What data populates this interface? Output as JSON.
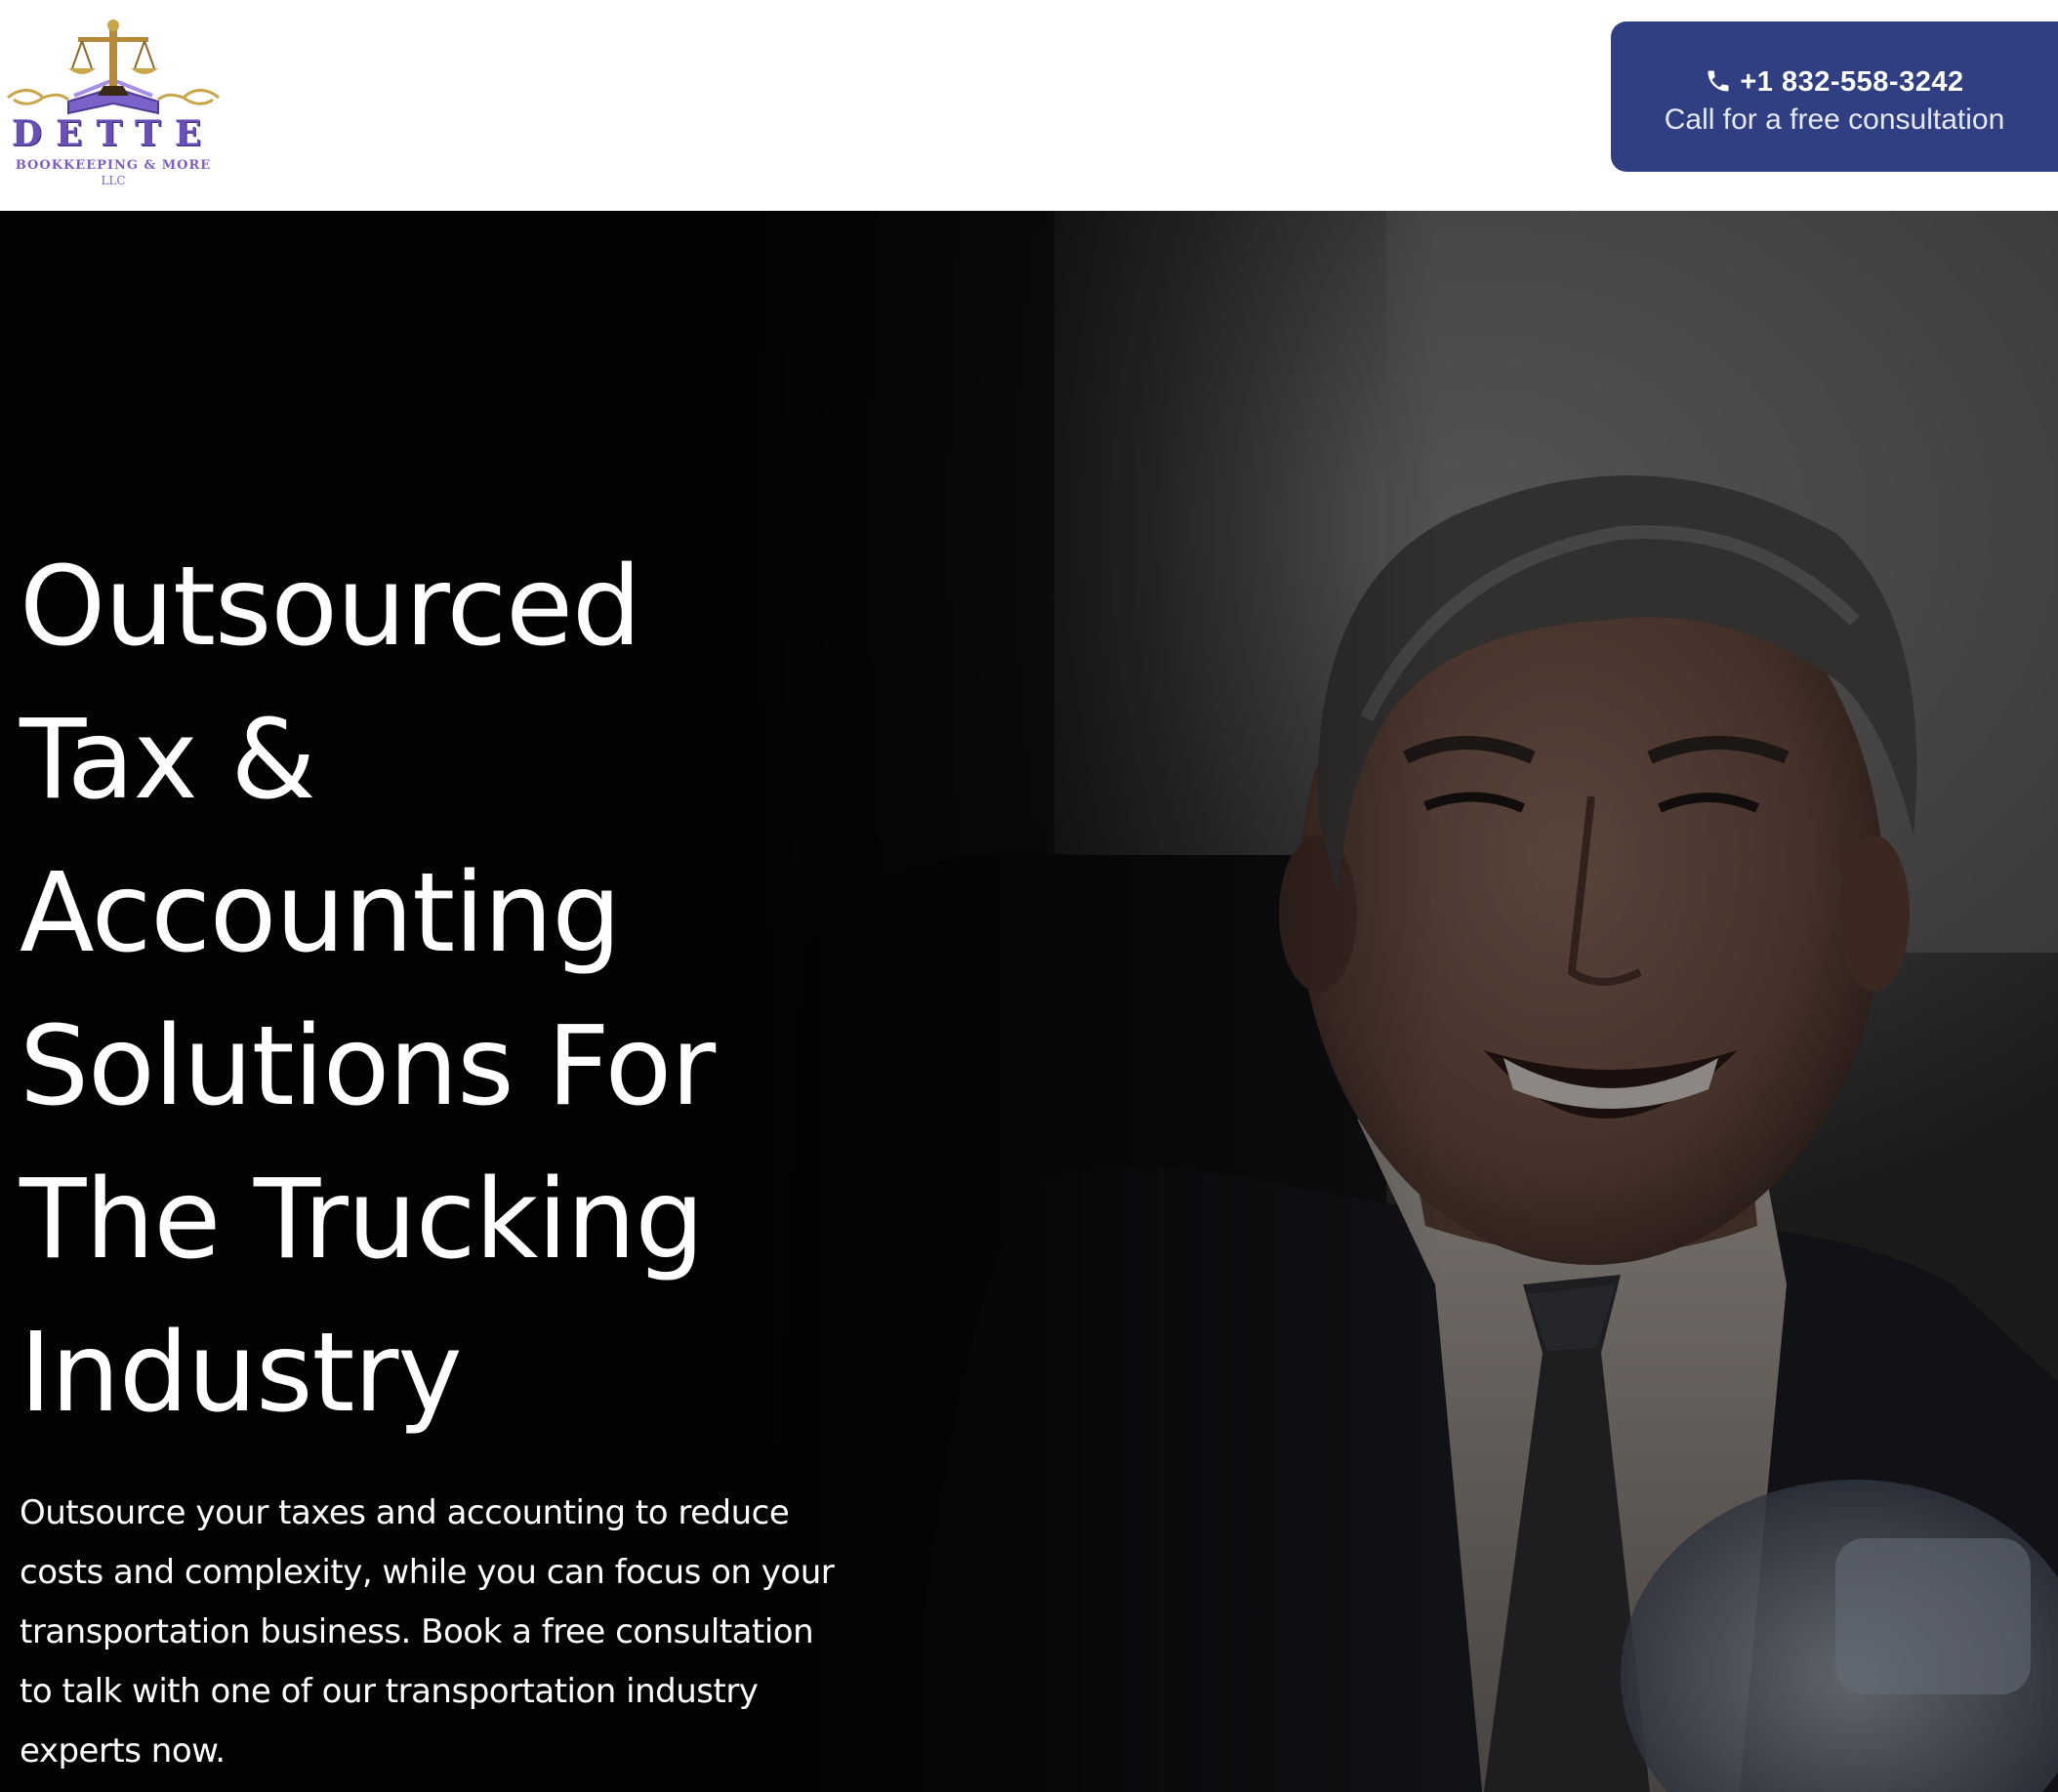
{
  "header": {
    "logo": {
      "wordmark": "DETTE",
      "tagline": "BOOKKEEPING & MORE",
      "suffix": "LLC"
    },
    "cta": {
      "phone": "+1 832-558-3242",
      "subtitle": "Call for a free consultation",
      "color": "#2f3f82",
      "icon": "phone-icon"
    }
  },
  "hero": {
    "headline_lines": [
      "Outsourced",
      "Tax &",
      "Accounting",
      "Solutions For",
      "The Trucking",
      "Industry"
    ],
    "paragraph_lines": [
      "Outsource your taxes and accounting to reduce",
      "costs and complexity, while you can focus on your",
      "transportation business. Book a free consultation",
      "to talk with one of our transportation industry",
      "experts now."
    ],
    "image": "smiling-businessman-photo"
  }
}
